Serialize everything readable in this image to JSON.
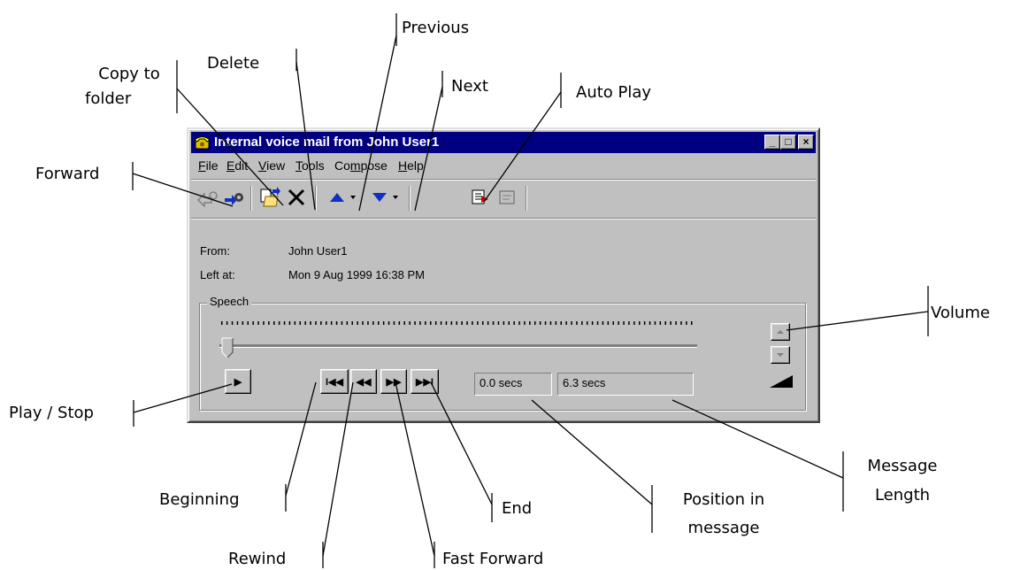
{
  "window": {
    "title": "Internal voice mail from John User1",
    "controls": [
      "_",
      "□",
      "×"
    ]
  },
  "menu": [
    {
      "pre": "",
      "u": "F",
      "post": "ile"
    },
    {
      "pre": "",
      "u": "E",
      "post": "dit"
    },
    {
      "pre": "",
      "u": "V",
      "post": "iew"
    },
    {
      "pre": "",
      "u": "T",
      "post": "ools"
    },
    {
      "pre": "Co",
      "u": "m",
      "post": "pose"
    },
    {
      "pre": "",
      "u": "H",
      "post": "elp"
    }
  ],
  "toolbar_icons": [
    "reply-icon",
    "forward-icon",
    "copy-to-folder-icon",
    "delete-icon",
    "previous-icon",
    "next-icon",
    "auto-play-icon",
    "dialog-icon"
  ],
  "message": {
    "from_label": "From:",
    "from_value": "John User1",
    "left_label": "Left at:",
    "left_value": "Mon 9 Aug 1999  16:38 PM"
  },
  "player": {
    "group_label": "Speech",
    "position": "0.0 secs",
    "length": "6.3 secs",
    "play_glyph": "▶",
    "beginning_glyph": "I◀◀",
    "rewind_glyph": "◀◀",
    "fast_forward_glyph": "▶▶",
    "end_glyph": "▶▶I",
    "slider_position": 0
  },
  "callouts": {
    "previous": "Previous",
    "delete": "Delete",
    "copy_to_folder": [
      "Copy to",
      "folder"
    ],
    "next": "Next",
    "auto_play": "Auto Play",
    "forward": "Forward",
    "volume": "Volume",
    "play_stop": "Play / Stop",
    "beginning": "Beginning",
    "rewind": "Rewind",
    "fast_forward": "Fast Forward",
    "end": "End",
    "position_in_message": [
      "Position in",
      "message"
    ],
    "message_length": [
      "Message",
      "Length"
    ]
  },
  "colors": {
    "titlebar": "#000080",
    "face": "#c0c0c0"
  }
}
